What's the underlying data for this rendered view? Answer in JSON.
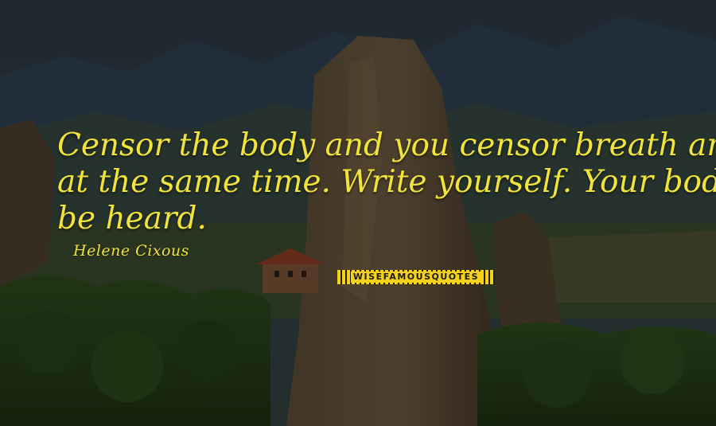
{
  "quote": {
    "line1": "Censor the body and you censor breath and speech",
    "line2": "at the same time. Write yourself. Your body must",
    "line3": "be heard."
  },
  "author": "Helene Cixous",
  "watermark": "WISEFAMOUSQUOTES",
  "colors": {
    "text": "#f2e33a",
    "watermark_bg": "#f4d21c"
  }
}
